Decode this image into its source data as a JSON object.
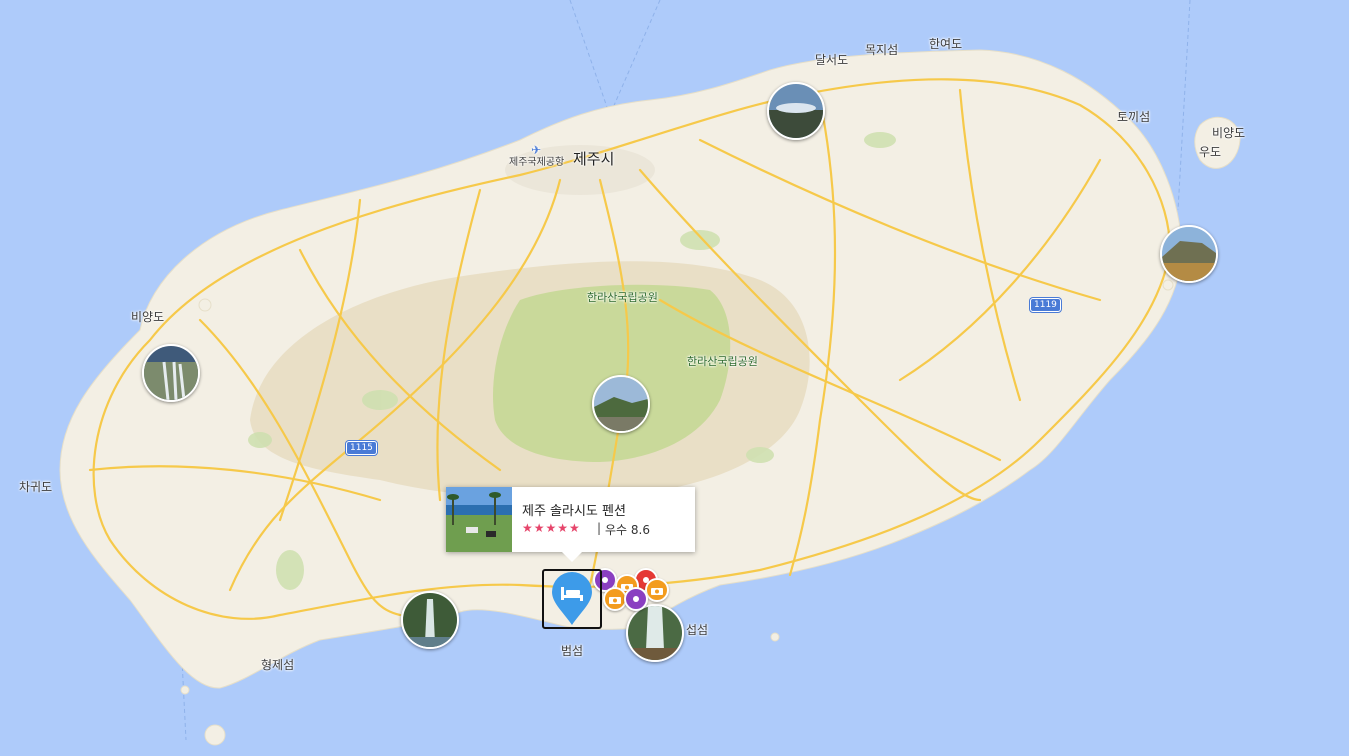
{
  "labels": {
    "jeju_city": "제주시",
    "airport": "제주국제공항",
    "dalseodo": "달서도",
    "mokjiseom": "목지섬",
    "hanyeodo": "한여도",
    "tokkiseom": "토끼섬",
    "biyangdo_east": "비양도",
    "udo": "우도",
    "biyangdo_west": "비양도",
    "chagwido": "차귀도",
    "hyeongjeseom": "형제섬",
    "beomseom": "범섬",
    "seopseom": "섭섬",
    "park_1": "한라산국립공원",
    "park_2": "한라산국립공원"
  },
  "roads": {
    "r1115": "1115",
    "r1119": "1119"
  },
  "popup": {
    "name": "제주 솔라시도 펜션",
    "stars": "★★★★★",
    "star_value": 4.5,
    "separator": "|",
    "rating": "우수 8.6"
  },
  "colors": {
    "sea": "#aecbfa",
    "land": "#f3efe4",
    "park": "#c9d99a",
    "road": "#f6c94a",
    "hotel_pin": "#3d9be9",
    "star": "#e6456b"
  },
  "icons": {
    "hotel_pin": "bed-pin-icon",
    "airport": "airplane-icon",
    "camera": "camera-icon",
    "sight": "sight-pin-icon",
    "food": "food-icon"
  }
}
